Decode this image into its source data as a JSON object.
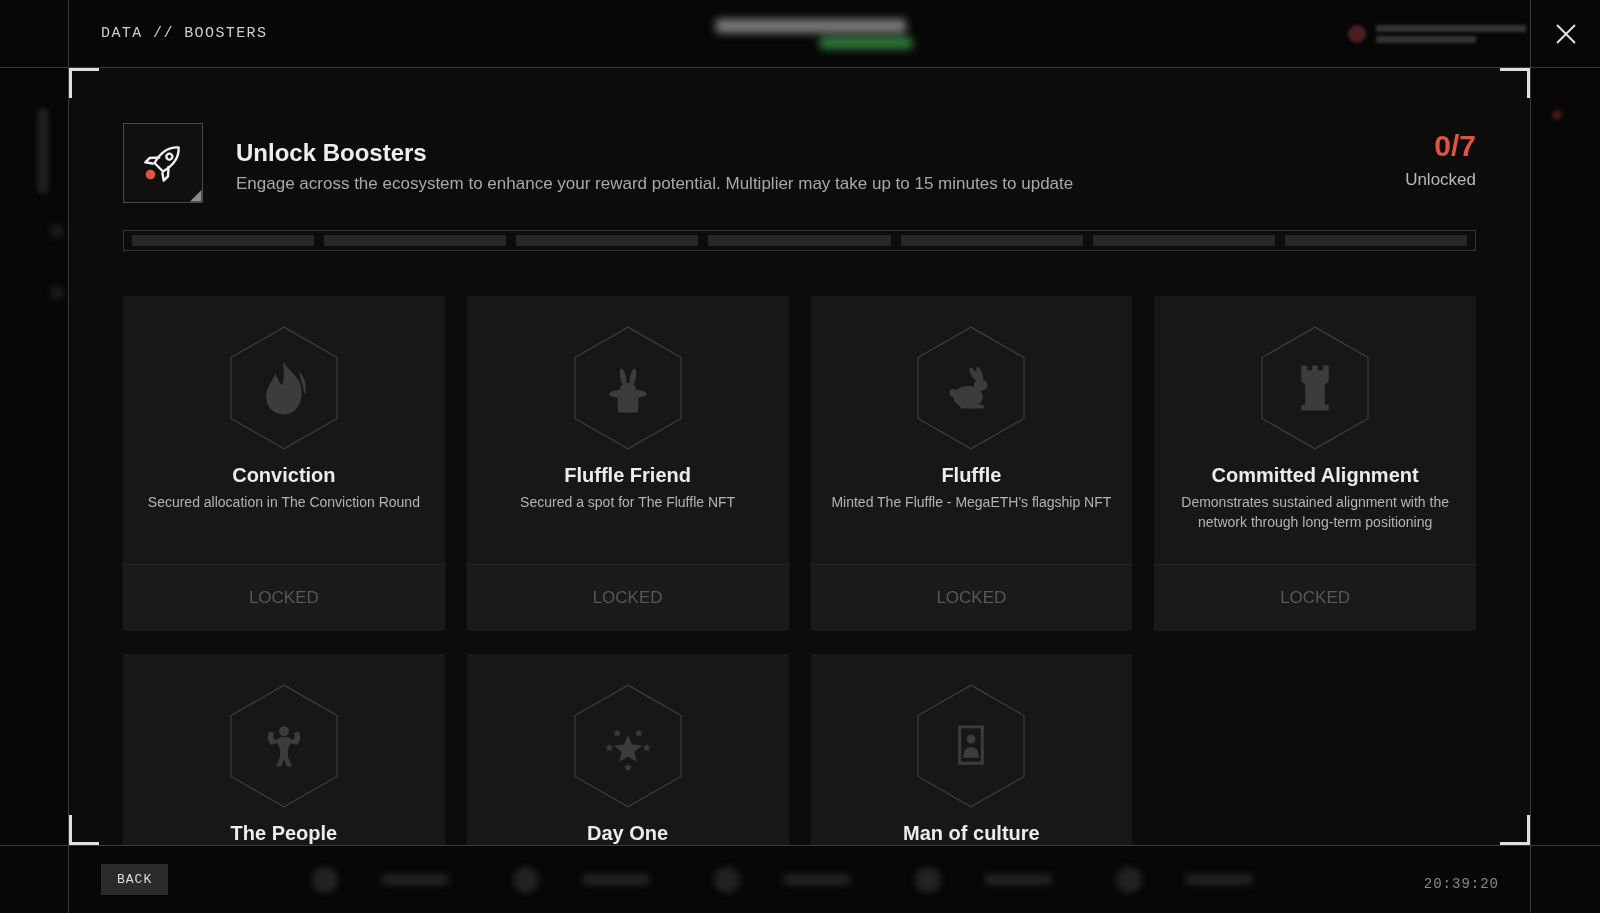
{
  "header": {
    "breadcrumb": "DATA // BOOSTERS"
  },
  "summary": {
    "title": "Unlock Boosters",
    "description": "Engage across the ecosystem to enhance your reward potential. Multiplier may take up to 15 minutes to update",
    "count": "0/7",
    "count_label": "Unlocked"
  },
  "progress": {
    "segments": [
      {
        "filled": false
      },
      {
        "filled": false
      },
      {
        "filled": false
      },
      {
        "filled": false
      },
      {
        "filled": false
      },
      {
        "filled": false
      },
      {
        "filled": false
      }
    ]
  },
  "boosters": [
    {
      "title": "Conviction",
      "description": "Secured allocation in The Conviction Round",
      "status": "LOCKED",
      "locked": true
    },
    {
      "title": "Fluffle Friend",
      "description": "Secured a spot for The Fluffle NFT",
      "status": "LOCKED",
      "locked": true
    },
    {
      "title": "Fluffle",
      "description": "Minted The Fluffle - MegaETH's flagship NFT",
      "status": "LOCKED",
      "locked": true
    },
    {
      "title": "Committed Alignment",
      "description": "Demonstrates sustained alignment with the network through long-term positioning",
      "status": "LOCKED",
      "locked": true
    },
    {
      "title": "The People",
      "locked": true
    },
    {
      "title": "Day One",
      "locked": true
    },
    {
      "title": "Man of culture",
      "locked": true
    }
  ],
  "footer": {
    "back_button": "BACK",
    "time": "20:39:20"
  }
}
